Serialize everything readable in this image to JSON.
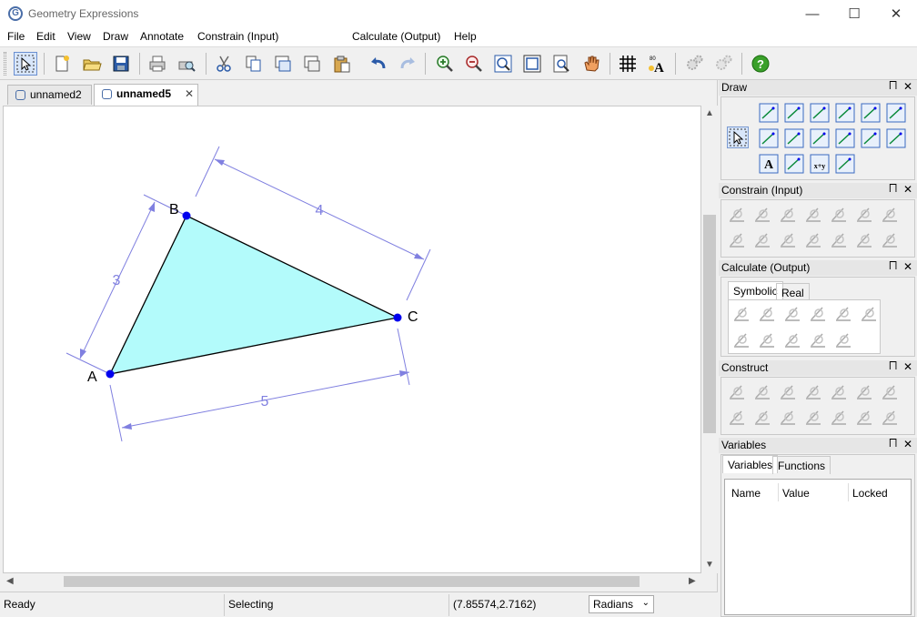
{
  "window": {
    "title": "Geometry Expressions",
    "logo_letter": "G",
    "min_glyph": "—",
    "max_glyph": "☐",
    "close_glyph": "✕"
  },
  "menu": [
    {
      "label": "File"
    },
    {
      "label": "Edit"
    },
    {
      "label": "View"
    },
    {
      "label": "Draw"
    },
    {
      "label": "Annotate"
    },
    {
      "label": "Constrain (Input)"
    },
    {
      "label": "Calculate (Output)"
    },
    {
      "label": "Help"
    }
  ],
  "toolbar": {
    "buttons": [
      "select-arrow-icon",
      "new-file-icon",
      "open-folder-icon",
      "save-disk-icon",
      "print-icon",
      "print-preview-icon",
      "cut-scissors-icon",
      "copy-icon",
      "copy-image-icon",
      "copy-expr-icon",
      "paste-icon",
      "undo-icon",
      "redo-icon",
      "zoom-in-icon",
      "zoom-out-icon",
      "zoom-fit-icon",
      "zoom-extent-icon",
      "zoom-page-icon",
      "pan-hand-icon",
      "grid-icon",
      "font-size-icon",
      "gear-icon",
      "gear-disabled-icon",
      "help-icon"
    ],
    "help_glyph": "?",
    "font_glyph": "A",
    "font_badge": "80"
  },
  "tabs": [
    {
      "label": "unnamed2",
      "active": false
    },
    {
      "label": "unnamed5",
      "active": true,
      "close_glyph": "✕"
    }
  ],
  "figure": {
    "points": [
      {
        "label": "A"
      },
      {
        "label": "B"
      },
      {
        "label": "C"
      }
    ],
    "dimensions": [
      {
        "label": "3",
        "between": "A-B"
      },
      {
        "label": "4",
        "between": "B-C"
      },
      {
        "label": "5",
        "between": "A-C"
      }
    ],
    "fill_color": "#b3fbfb",
    "point_color": "#0000ee",
    "dimension_color": "#8080e0"
  },
  "status": {
    "ready": "Ready",
    "mode": "Selecting",
    "coords": "(7.85574,2.7162)",
    "angle_unit": "Radians"
  },
  "panels": {
    "draw": {
      "title": "Draw",
      "text_tool_glyph": "A",
      "expr_tool_label": "x+y"
    },
    "constrain": {
      "title": "Constrain (Input)"
    },
    "calculate": {
      "title": "Calculate (Output)",
      "tabs": [
        "Symbolic",
        "Real"
      ]
    },
    "construct": {
      "title": "Construct"
    },
    "variables": {
      "title": "Variables",
      "tabs": [
        "Variables",
        "Functions"
      ],
      "columns": [
        "Name",
        "Value",
        "Locked"
      ]
    },
    "pin_glyph": "⨅",
    "close_glyph": "✕"
  }
}
